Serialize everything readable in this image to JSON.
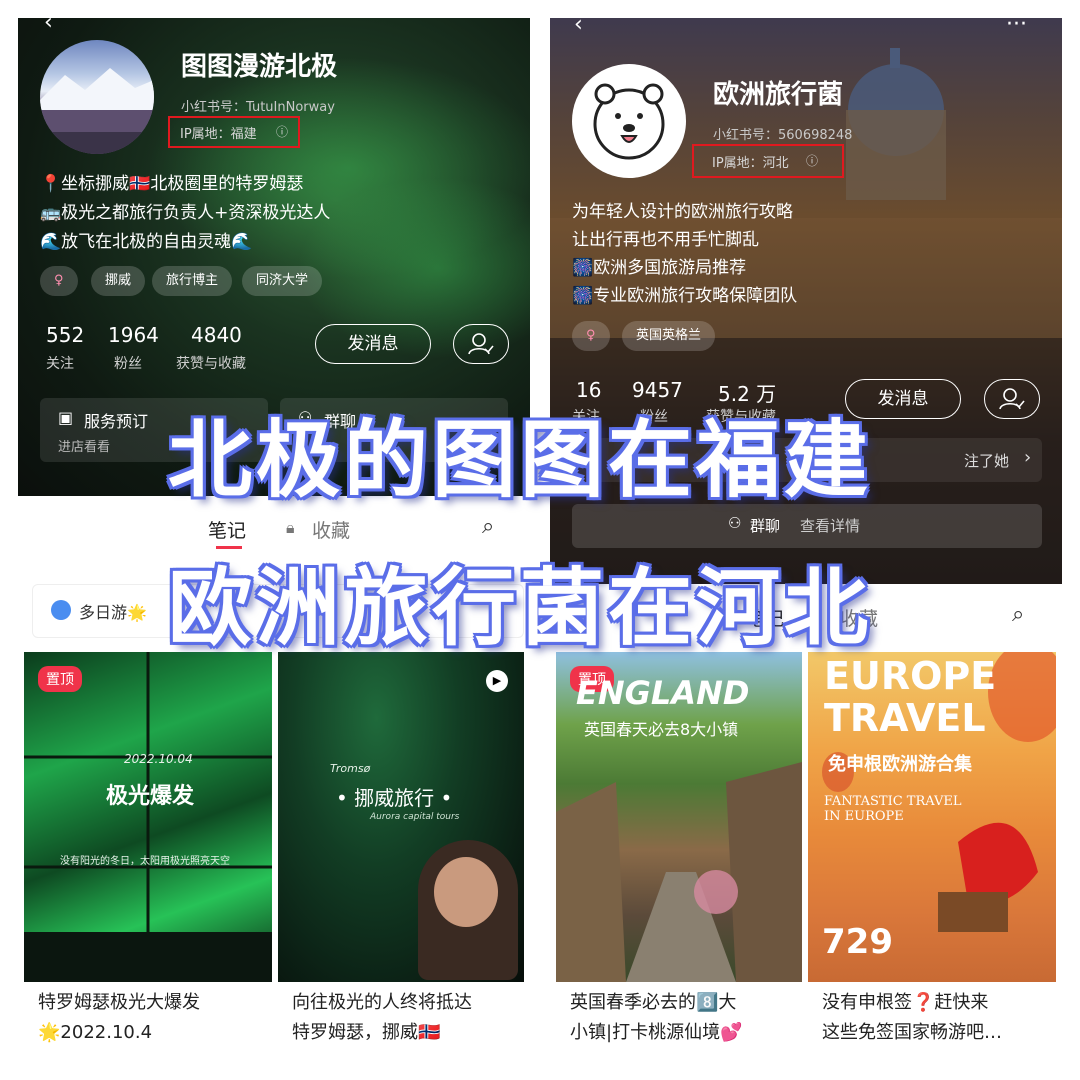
{
  "left": {
    "title": "图图漫游北极",
    "account_id": "小红书号：TutuInNorway",
    "ip_location": "IP属地：福建",
    "bio": [
      "📍坐标挪威🇳🇴北极圈里的特罗姆瑟",
      "🚌极光之都旅行负责人+资深极光达人",
      "🌊放飞在北极的自由灵魂🌊"
    ],
    "tags": [
      "♀",
      "挪威",
      "旅行博主",
      "同济大学"
    ],
    "stats": [
      {
        "value": "552",
        "label": "关注"
      },
      {
        "value": "1964",
        "label": "粉丝"
      },
      {
        "value": "4840",
        "label": "获赞与收藏"
      }
    ],
    "message_button": "发消息",
    "services": [
      {
        "title": "服务预订",
        "sub": "进店看看"
      },
      {
        "title": "群聊",
        "sub": ""
      }
    ],
    "tabs": [
      "笔记",
      "收藏"
    ],
    "chip": "多日游🌟",
    "cards": [
      {
        "pin": "置顶",
        "img_text": "极光爆发",
        "img_date": "2022.10.04",
        "img_sub": "没有阳光的冬日，太阳用极光照亮天空",
        "caption": [
          "特罗姆瑟极光大爆发",
          "🌟2022.10.4"
        ]
      },
      {
        "img_script_top": "Tromsø",
        "img_text": "• 挪威旅行 •",
        "img_sub": "Aurora capital tours",
        "caption": [
          "向往极光的人终将抵达",
          "特罗姆瑟，挪威🇳🇴"
        ]
      }
    ]
  },
  "right": {
    "title": "欧洲旅行菌",
    "account_id": "小红书号：560698248",
    "ip_location": "IP属地：河北",
    "bio": [
      "为年轻人设计的欧洲旅行攻略",
      "让出行再也不用手忙脚乱",
      "🎆欧洲多国旅游局推荐",
      "🎆专业欧洲旅行攻略保障团队"
    ],
    "tags": [
      "♀",
      "英国英格兰"
    ],
    "stats": [
      {
        "value": "16",
        "label": "关注"
      },
      {
        "value": "9457",
        "label": "粉丝"
      },
      {
        "value": "5.2 万",
        "label": "获赞与收藏"
      }
    ],
    "message_button": "发消息",
    "followed_text": "注了她",
    "group_chat": "群聊",
    "group_detail": "查看详情",
    "tabs": [
      "笔记",
      "收藏"
    ],
    "cards": [
      {
        "pin": "置顶",
        "img_title": "ENGLAND",
        "img_sub": "英国春天必去8大小镇",
        "caption": [
          "英国春季必去的8️⃣大",
          "小镇|打卡桃源仙境💕"
        ]
      },
      {
        "img_title1": "EUROPE",
        "img_title2": "TRAVEL",
        "img_sub": "免申根欧洲游合集",
        "img_en": "FANTASTIC TRAVEL IN EUROPE",
        "img_price": "729",
        "caption": [
          "没有申根签❓赶快来",
          "这些免签国家畅游吧…"
        ]
      }
    ]
  },
  "overlay": {
    "line1": "北极的图图在福建",
    "line2": "欧洲旅行菌在河北"
  },
  "colors": {
    "highlight": "#e0191f",
    "pin": "#f0334a",
    "overlay_outline": "#5b6ee8"
  }
}
